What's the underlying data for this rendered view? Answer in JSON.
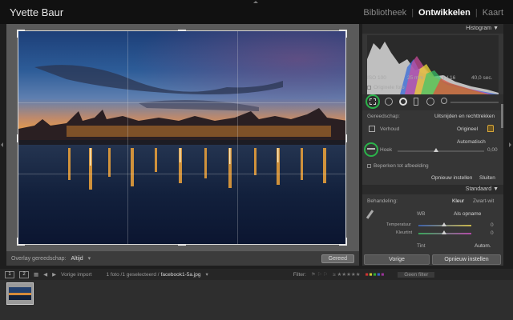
{
  "app": {
    "title": "Yvette Baur"
  },
  "modules": [
    {
      "label": "Bibliotheek",
      "active": false
    },
    {
      "label": "Ontwikkelen",
      "active": true
    },
    {
      "label": "Kaart",
      "active": false
    }
  ],
  "histogram": {
    "header": "Histogram",
    "iso": "ISO 100",
    "focal": "25 mm",
    "aperture": "ƒ / 16",
    "shutter": "40,0 sec.",
    "original_photo_label": "Originele foto"
  },
  "crop_panel": {
    "tool_label": "Gereedschap:",
    "tool_value": "Uitsnijden en rechttrekken",
    "ratio_label": "Verhoud",
    "ratio_value": "Origineel",
    "auto_button": "Automatisch",
    "angle_label": "Hoek",
    "angle_value": "0,00",
    "constrain_label": "Beperken tot afbeelding",
    "reset_label": "Opnieuw instellen",
    "close_label": "Sluiten"
  },
  "basic_panel": {
    "header": "Standaard",
    "treatment_label": "Behandeling:",
    "treatment_color": "Kleur",
    "treatment_bw": "Zwart-wit",
    "wb_label": "WB",
    "wb_value": "Als opname",
    "temp_label": "Temperatuur",
    "temp_value": "0",
    "tint_label": "Kleurtint",
    "tint_value": "0",
    "tone_label": "Tint",
    "tone_auto": "Autom."
  },
  "buttons": {
    "previous": "Vorige",
    "reset": "Opnieuw instellen",
    "done": "Gereed"
  },
  "overlay": {
    "label": "Overlay gereedschap:",
    "value": "Altijd"
  },
  "filmstrip": {
    "monitor1": "1",
    "monitor2": "2",
    "prev_import": "Vorige import",
    "selection_info": "1 foto /1 geselecteerd /",
    "filename": "facebook1-5a.jpg",
    "filter_label": "Filter:",
    "filter_value": "Geen filter"
  },
  "colors": {
    "accent_highlight": "#2bb34a",
    "active_module": "#ffffff",
    "panel_bg": "#363636"
  }
}
